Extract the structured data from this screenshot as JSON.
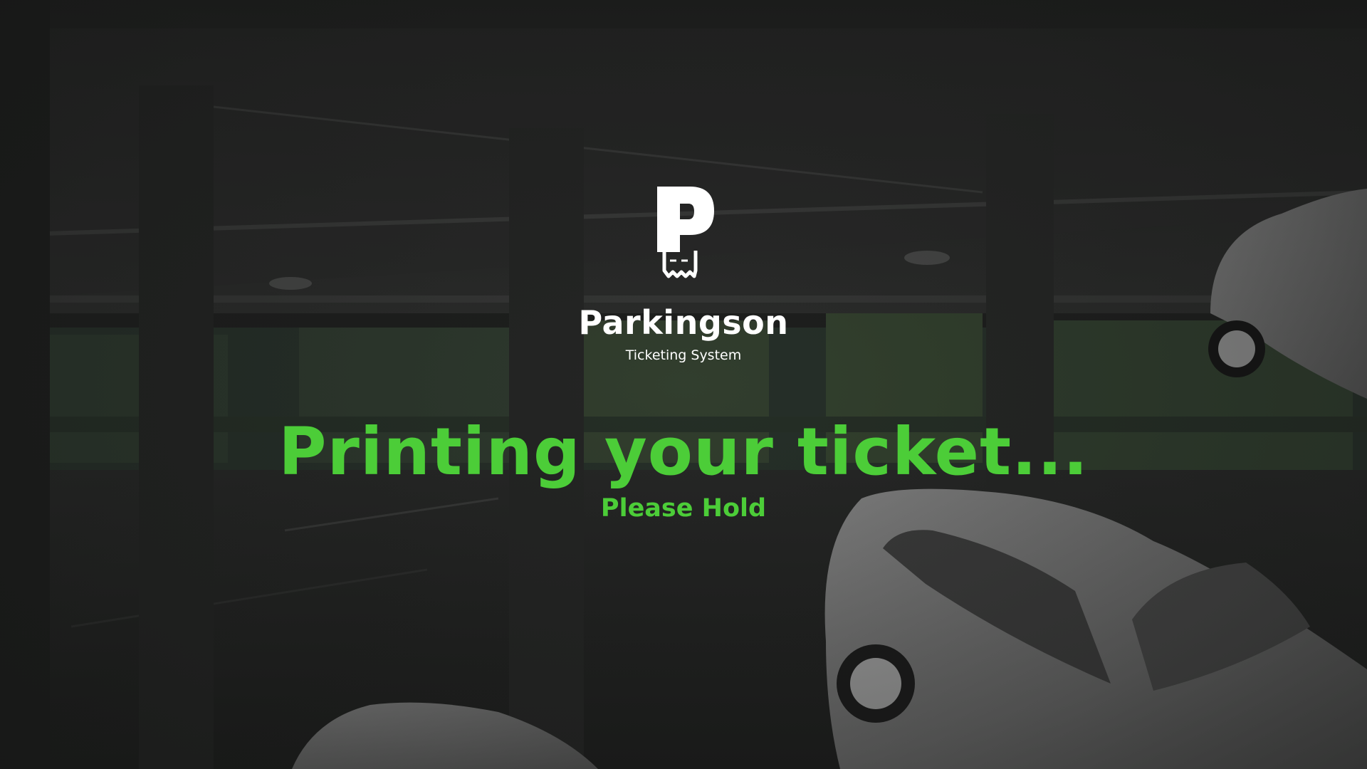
{
  "app": {
    "name": "Parkingson",
    "subtitle": "Ticketing System",
    "logo_icon": "parking-ticket-icon"
  },
  "status": {
    "headline": "Printing your ticket...",
    "message": "Please Hold"
  },
  "colors": {
    "accent": "#4ccd38",
    "text": "#ffffff",
    "background": "#1e1f1e"
  }
}
